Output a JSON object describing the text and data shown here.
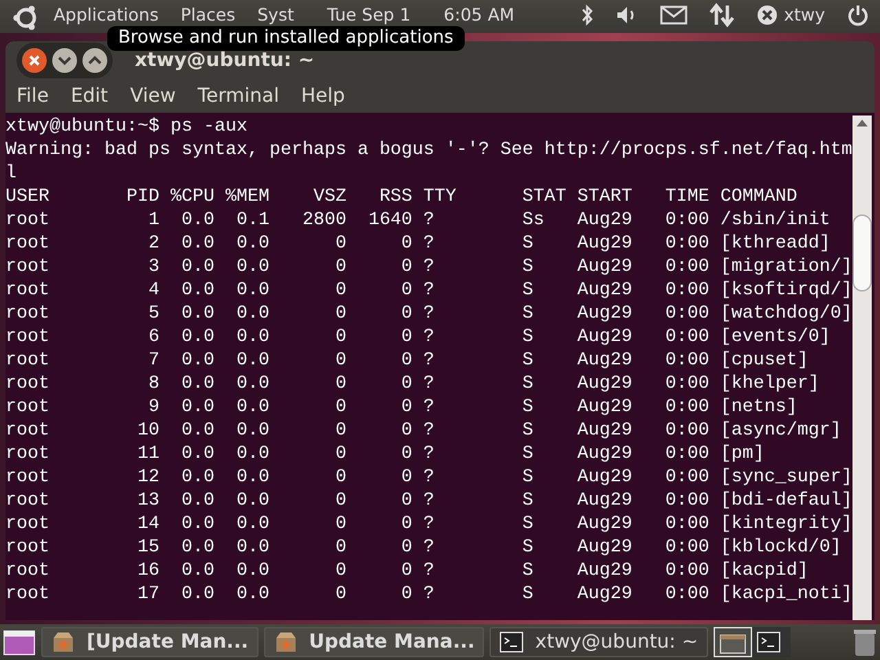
{
  "top_panel": {
    "menus": [
      "Applications",
      "Places",
      "Syst"
    ],
    "date": "Tue Sep 1",
    "time": "6:05 AM",
    "user": "xtwy"
  },
  "tooltip": "Browse and run installed applications",
  "window": {
    "title": "xtwy@ubuntu: ~",
    "menu": [
      "File",
      "Edit",
      "View",
      "Terminal",
      "Help"
    ],
    "lines": [
      "xtwy@ubuntu:~$ ps -aux",
      "Warning: bad ps syntax, perhaps a bogus '-'? See http://procps.sf.net/faq.htm",
      "l",
      "USER       PID %CPU %MEM    VSZ   RSS TTY      STAT START   TIME COMMAND",
      "root         1  0.0  0.1   2800  1640 ?        Ss   Aug29   0:00 /sbin/init",
      "root         2  0.0  0.0      0     0 ?        S    Aug29   0:00 [kthreadd]",
      "root         3  0.0  0.0      0     0 ?        S    Aug29   0:00 [migration/]",
      "root         4  0.0  0.0      0     0 ?        S    Aug29   0:00 [ksoftirqd/]",
      "root         5  0.0  0.0      0     0 ?        S    Aug29   0:00 [watchdog/0]",
      "root         6  0.0  0.0      0     0 ?        S    Aug29   0:00 [events/0]",
      "root         7  0.0  0.0      0     0 ?        S    Aug29   0:00 [cpuset]",
      "root         8  0.0  0.0      0     0 ?        S    Aug29   0:00 [khelper]",
      "root         9  0.0  0.0      0     0 ?        S    Aug29   0:00 [netns]",
      "root        10  0.0  0.0      0     0 ?        S    Aug29   0:00 [async/mgr]",
      "root        11  0.0  0.0      0     0 ?        S    Aug29   0:00 [pm]",
      "root        12  0.0  0.0      0     0 ?        S    Aug29   0:00 [sync_super]",
      "root        13  0.0  0.0      0     0 ?        S    Aug29   0:00 [bdi-defaul]",
      "root        14  0.0  0.0      0     0 ?        S    Aug29   0:00 [kintegrity]",
      "root        15  0.0  0.0      0     0 ?        S    Aug29   0:00 [kblockd/0]",
      "root        16  0.0  0.0      0     0 ?        S    Aug29   0:00 [kacpid]",
      "root        17  0.0  0.0      0     0 ?        S    Aug29   0:00 [kacpi_noti]"
    ]
  },
  "taskbar": {
    "tasks": [
      {
        "kind": "package",
        "label": "[Update Man...",
        "selected": false
      },
      {
        "kind": "package",
        "label": "Update Mana...",
        "selected": false
      },
      {
        "kind": "terminal",
        "label": "xtwy@ubuntu: ~",
        "selected": true
      }
    ],
    "workspaces": [
      {
        "kind": "desktop",
        "selected": true
      },
      {
        "kind": "terminal",
        "selected": false
      }
    ]
  }
}
